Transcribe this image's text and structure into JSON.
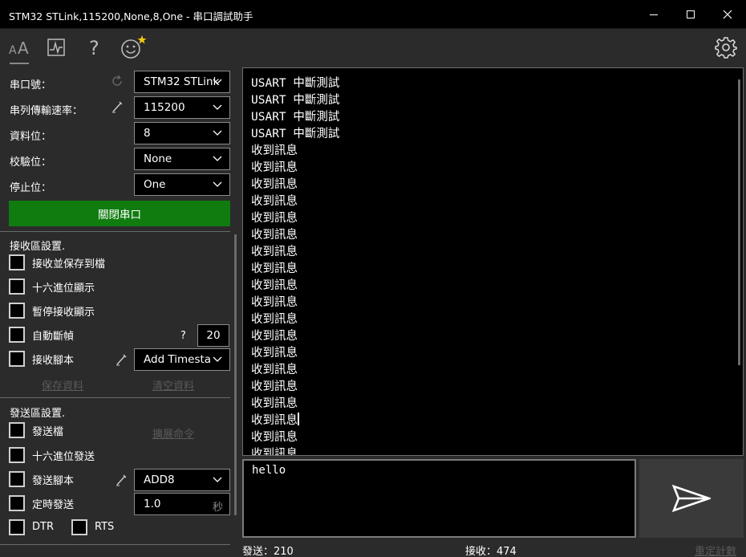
{
  "window": {
    "title": "STM32 STLink,115200,None,8,One - 串口調試助手"
  },
  "port": {
    "port_label": "串口號：",
    "port_value": "STM32 STLink",
    "baud_label": "串列傳輸速率：",
    "baud_value": "115200",
    "databits_label": "資料位：",
    "databits_value": "8",
    "parity_label": "校驗位：",
    "parity_value": "None",
    "stopbits_label": "停止位：",
    "stopbits_value": "One",
    "open_button": "關閉串口"
  },
  "receive_settings": {
    "title": "接收區設置.",
    "save_to_file": "接收並保存到檔",
    "hex_display": "十六進位顯示",
    "pause_display": "暫停接收顯示",
    "auto_frame": "自動斷幀",
    "auto_frame_help": "?",
    "auto_frame_value": "20",
    "script_label": "接收腳本",
    "script_value": "Add Timesta",
    "save_data": "保存資料",
    "clear_data": "清空資料"
  },
  "send_settings": {
    "title": "發送區設置.",
    "send_file": "發送檔",
    "extend_command": "擴展命令",
    "hex_send": "十六進位發送",
    "script_label": "發送腳本",
    "script_value": "ADD8",
    "timed_send": "定時發送",
    "timed_value": "1.0",
    "timed_unit": "秒",
    "dtr": "DTR",
    "rts": "RTS"
  },
  "receive_area": {
    "lines": [
      "USART 中斷測試",
      "USART 中斷測試",
      "USART 中斷測試",
      "USART 中斷測試",
      "收到訊息",
      "收到訊息",
      "收到訊息",
      "收到訊息",
      "收到訊息",
      "收到訊息",
      "收到訊息",
      "收到訊息",
      "收到訊息",
      "收到訊息",
      "收到訊息",
      "收到訊息",
      "收到訊息",
      "收到訊息",
      "收到訊息",
      "收到訊息",
      "收到訊息",
      "收到訊息",
      "收到訊息"
    ]
  },
  "send_area": {
    "text": "hello"
  },
  "status": {
    "sent": "發送：210",
    "received": "接收：474",
    "reset": "重定計數"
  },
  "icons": {
    "font": "font-size-icon",
    "chart": "chart-icon",
    "help": "help-icon",
    "emoji": "emoji-icon",
    "settings": "gear-icon",
    "send": "send-icon"
  },
  "colors": {
    "accent_green": "#107c10",
    "panel": "#2b2b2b",
    "background": "#000000"
  }
}
